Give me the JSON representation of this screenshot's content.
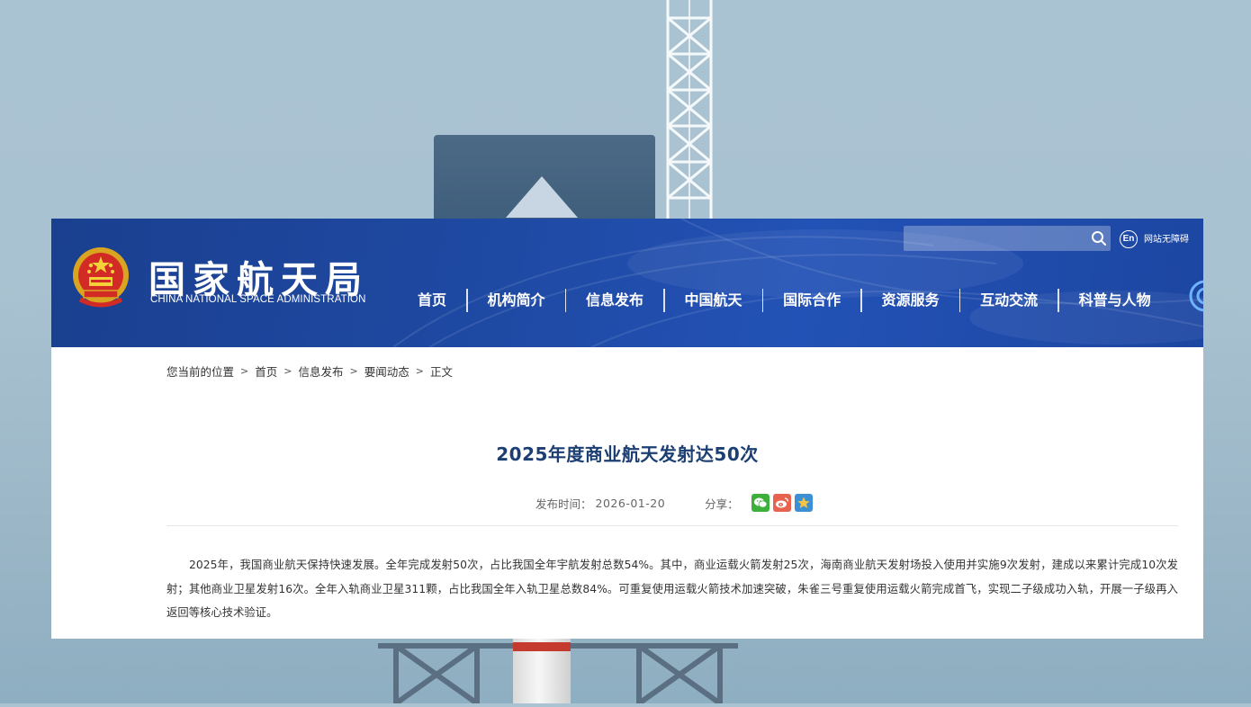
{
  "site": {
    "logo_cn": "国家航天局",
    "logo_en": "CHINA NATIONAL SPACE ADMINISTRATION",
    "search_placeholder": "",
    "en_label": "En",
    "accessible_label": "网站无障碍"
  },
  "nav": {
    "items": [
      {
        "label": "首页"
      },
      {
        "label": "机构简介"
      },
      {
        "label": "信息发布"
      },
      {
        "label": "中国航天"
      },
      {
        "label": "国际合作"
      },
      {
        "label": "资源服务"
      },
      {
        "label": "互动交流"
      },
      {
        "label": "科普与人物"
      }
    ]
  },
  "breadcrumb": {
    "prefix": "您当前的位置",
    "items": [
      "首页",
      "信息发布",
      "要闻动态",
      "正文"
    ],
    "separator": ">"
  },
  "article": {
    "title": "2025年度商业航天发射达50次",
    "publish_label": "发布时间：",
    "publish_date": "2026-01-20",
    "share_label": "分享：",
    "body": "2025年，我国商业航天保持快速发展。全年完成发射50次，占比我国全年宇航发射总数54%。其中，商业运载火箭发射25次，海南商业航天发射场投入使用并实施9次发射，建成以来累计完成10次发射；其他商业卫星发射16次。全年入轨商业卫星311颗，占比我国全年入轨卫星总数84%。可重复使用运载火箭技术加速突破，朱雀三号重复使用运载火箭完成首飞，实现二子级成功入轨，开展一子级再入返回等核心技术验证。"
  },
  "icons": {
    "search": "search-icon",
    "en": "en-icon",
    "emblem": "national-emblem-icon",
    "wechat": "wechat-icon",
    "weibo": "weibo-icon",
    "favorite": "favorite-icon"
  },
  "colors": {
    "banner": "#1f4aa4",
    "title": "#1c3f73",
    "wechat": "#3db03b",
    "weibo": "#e8624f",
    "favorite": "#3b8fd2"
  }
}
